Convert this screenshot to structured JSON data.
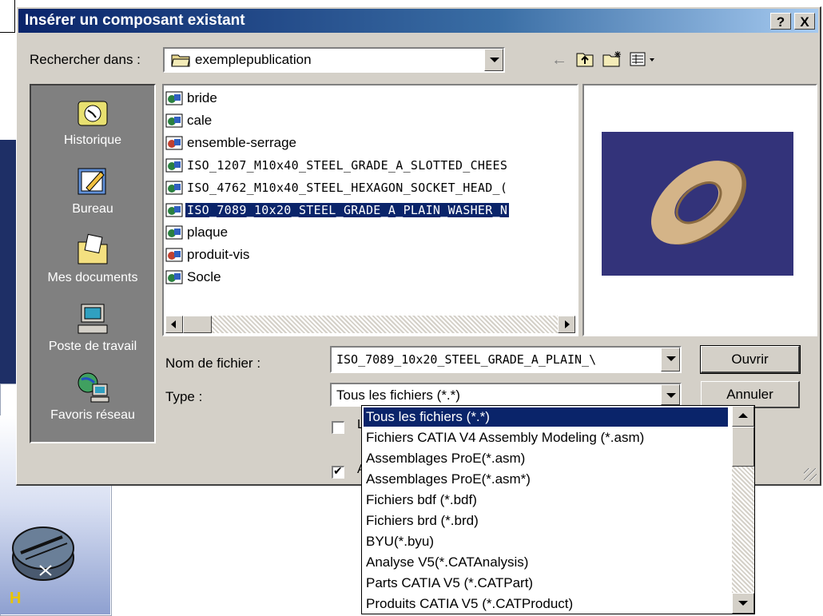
{
  "dialog": {
    "title": "Insérer un composant existant",
    "help_label": "?",
    "close_label": "X"
  },
  "lookin": {
    "label": "Rechercher dans :",
    "value": "exemplepublication"
  },
  "places": [
    {
      "label": "Historique",
      "icon": "history-icon"
    },
    {
      "label": "Bureau",
      "icon": "desktop-icon"
    },
    {
      "label": "Mes documents",
      "icon": "my-documents-icon"
    },
    {
      "label": "Poste de travail",
      "icon": "my-computer-icon"
    },
    {
      "label": "Favoris réseau",
      "icon": "network-places-icon"
    }
  ],
  "files": [
    {
      "name": "bride",
      "kind": "part"
    },
    {
      "name": "cale",
      "kind": "part"
    },
    {
      "name": "ensemble-serrage",
      "kind": "product"
    },
    {
      "name": "ISO_1207_M10x40_STEEL_GRADE_A_SLOTTED_CHEES",
      "kind": "part"
    },
    {
      "name": "ISO_4762_M10x40_STEEL_HEXAGON_SOCKET_HEAD_(",
      "kind": "part"
    },
    {
      "name": "ISO_7089_10x20_STEEL_GRADE_A_PLAIN_WASHER_N",
      "kind": "part"
    },
    {
      "name": "plaque",
      "kind": "part"
    },
    {
      "name": "produit-vis",
      "kind": "product"
    },
    {
      "name": "Socle",
      "kind": "part"
    }
  ],
  "selected_file_index": 5,
  "filename": {
    "label": "Nom de fichier :",
    "value": "ISO_7089_10x20_STEEL_GRADE_A_PLAIN_\\"
  },
  "type": {
    "label": "Type :",
    "value": "Tous les fichiers (*.*)"
  },
  "buttons": {
    "open": "Ouvrir",
    "cancel": "Annuler"
  },
  "checkboxes": [
    {
      "label": "L",
      "checked": false
    },
    {
      "label": "A",
      "checked": true
    }
  ],
  "type_options": [
    "Tous les fichiers (*.*)",
    "Fichiers CATIA V4 Assembly Modeling (*.asm)",
    "Assemblages ProE(*.asm)",
    "Assemblages ProE(*.asm*)",
    "Fichiers bdf (*.bdf)",
    "Fichiers brd (*.brd)",
    "BYU(*.byu)",
    "Analyse V5(*.CATAnalysis)",
    "Parts CATIA V5 (*.CATPart)",
    "Produits CATIA V5 (*.CATProduct)"
  ],
  "selected_type_index": 0,
  "background": {
    "axis_label": "H"
  },
  "colors": {
    "title_start": "#0a246a",
    "title_end": "#a6caf0",
    "selection": "#0a246a",
    "dialog_face": "#d4d0c8",
    "preview_bg": "#33337a",
    "washer": "#c8a878"
  }
}
